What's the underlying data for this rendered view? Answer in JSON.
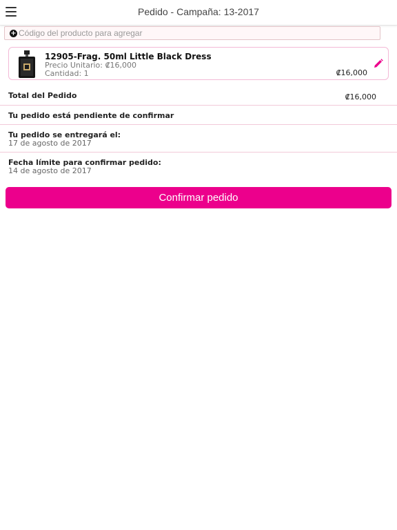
{
  "header": {
    "title": "Pedido - Campaña: 13-2017"
  },
  "search": {
    "placeholder": "Código del producto para agregar"
  },
  "product": {
    "name": "12905-Frag. 50ml Little Black Dress",
    "unit_price": "Precio Unitario: ₡16,000",
    "quantity": "Cantidad: 1",
    "total": "₡16,000"
  },
  "summary": {
    "total_label": "Total del Pedido",
    "total_value": "₡16,000",
    "status_label": "Tu pedido está pendiente de confirmar",
    "delivery_label": "Tu pedido se entregará el:",
    "delivery_date": "17 de agosto de 2017",
    "deadline_label": "Fecha límite para confirmar pedido:",
    "deadline_date": "14 de agosto de 2017"
  },
  "actions": {
    "confirm_label": "Confirmar pedido"
  },
  "colors": {
    "accent": "#ec008c",
    "border": "#f3b9d6"
  }
}
